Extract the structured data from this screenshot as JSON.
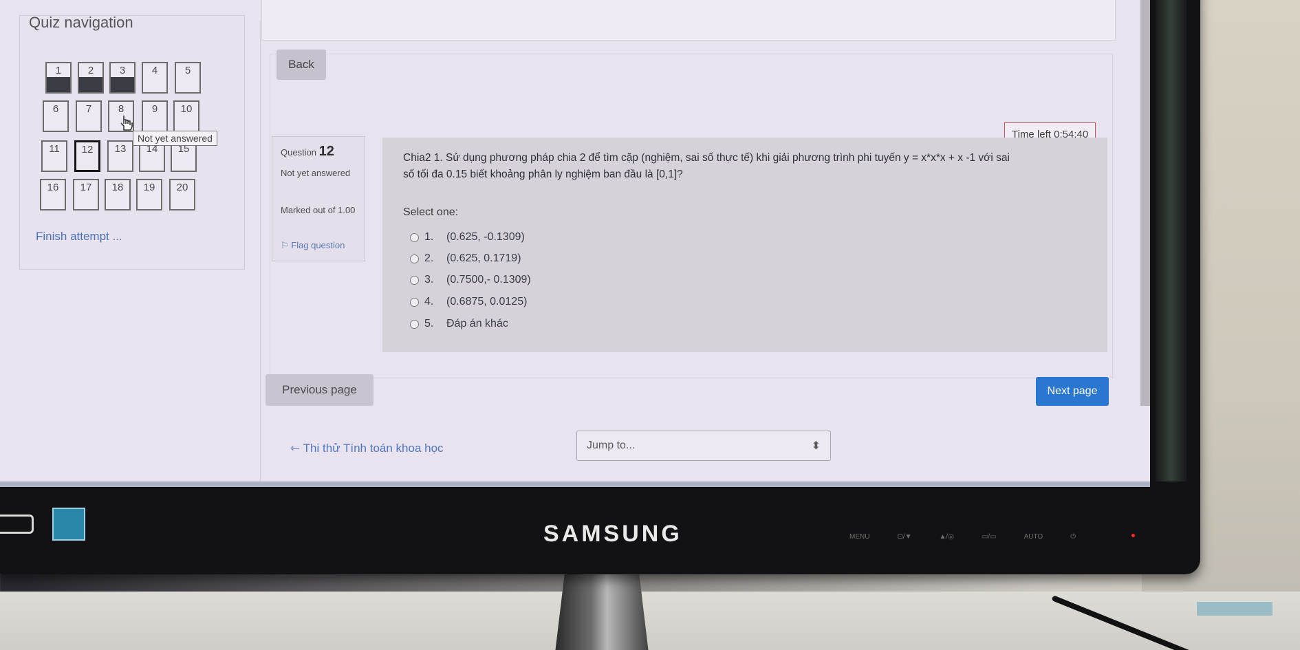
{
  "quiz_nav": {
    "title": "Quiz navigation",
    "questions": [
      {
        "n": "1",
        "state": "answered"
      },
      {
        "n": "2",
        "state": "answered"
      },
      {
        "n": "3",
        "state": "answered"
      },
      {
        "n": "4",
        "state": "not_answered"
      },
      {
        "n": "5",
        "state": "not_answered"
      },
      {
        "n": "6",
        "state": "not_answered"
      },
      {
        "n": "7",
        "state": "not_answered"
      },
      {
        "n": "8",
        "state": "not_answered"
      },
      {
        "n": "9",
        "state": "not_answered"
      },
      {
        "n": "10",
        "state": "not_answered"
      },
      {
        "n": "11",
        "state": "not_answered"
      },
      {
        "n": "12",
        "state": "current"
      },
      {
        "n": "13",
        "state": "not_answered"
      },
      {
        "n": "14",
        "state": "not_answered"
      },
      {
        "n": "15",
        "state": "not_answered"
      },
      {
        "n": "16",
        "state": "not_answered"
      },
      {
        "n": "17",
        "state": "not_answered"
      },
      {
        "n": "18",
        "state": "not_answered"
      },
      {
        "n": "19",
        "state": "not_answered"
      },
      {
        "n": "20",
        "state": "not_answered"
      }
    ],
    "tooltip": "Not yet answered",
    "finish_link": "Finish attempt ..."
  },
  "back_label": "Back",
  "timer": "Time left 0:54:40",
  "question_info": {
    "label": "Question",
    "number": "12",
    "state": "Not yet answered",
    "marked": "Marked out of 1.00",
    "flag": "Flag question"
  },
  "question": {
    "text_line1": "Chia2 1. Sử dụng phương pháp chia 2 để tìm cặp (nghiệm, sai số thực tế) khi giải phương trình phi tuyến y = x*x*x + x -1 với sai",
    "text_line2": "số tối đa 0.15 biết khoảng phân ly nghiệm ban đầu là [0,1]?",
    "select_prompt": "Select one:",
    "options": [
      {
        "num": "1.",
        "text": "(0.625, -0.1309)"
      },
      {
        "num": "2.",
        "text": "(0.625, 0.1719)"
      },
      {
        "num": "3.",
        "text": "(0.7500,- 0.1309)"
      },
      {
        "num": "4.",
        "text": "(0.6875, 0.0125)"
      },
      {
        "num": "5.",
        "text": "Đáp án khác"
      }
    ]
  },
  "nav_buttons": {
    "prev": "Previous page",
    "next": "Next page"
  },
  "footer": {
    "course_link": "Thi thử Tính toán khoa học",
    "jump_placeholder": "Jump to..."
  },
  "monitor": {
    "brand": "SAMSUNG",
    "controls": [
      "MENU",
      "⊡/▼",
      "▲/◎",
      "▭/▭",
      "AUTO",
      "⏻"
    ]
  },
  "colors": {
    "next_button": "#2a77d1",
    "link": "#4f77bc",
    "timer_border": "#c25a5a"
  }
}
